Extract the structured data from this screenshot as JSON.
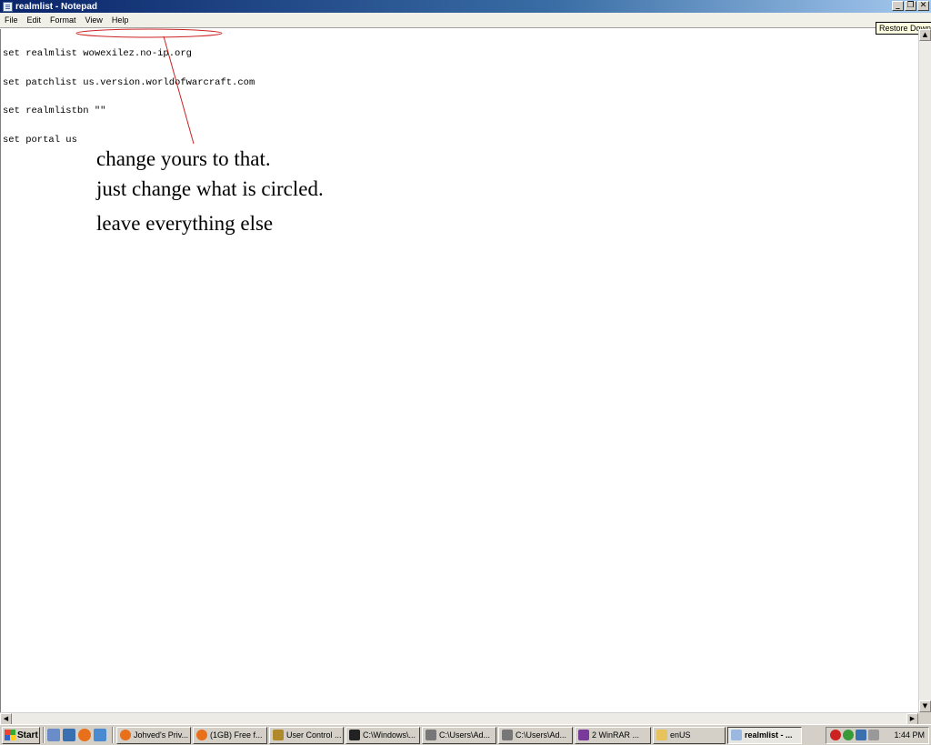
{
  "window": {
    "title": "realmlist - Notepad",
    "buttons": {
      "minimize": "_",
      "restore": "❐",
      "close": "✕"
    },
    "tooltip": "Restore Down"
  },
  "menu": [
    "File",
    "Edit",
    "Format",
    "View",
    "Help"
  ],
  "document": {
    "lines": [
      "set realmlist wowexilez.no-ip.org",
      "set patchlist us.version.worldofwarcraft.com",
      "set realmlistbn \"\"",
      "set portal us"
    ],
    "annotations": [
      "change yours to that.",
      "just change what is circled.",
      "leave everything else"
    ],
    "annotation_color": "#cc2222"
  },
  "scrollbars": {
    "up": "▲",
    "down": "▼",
    "left": "◀",
    "right": "▶"
  },
  "taskbar": {
    "start_label": "Start",
    "tasks": [
      {
        "label": "Johved's Priv...",
        "icon": "firefox-icon",
        "color": "#e8701a"
      },
      {
        "label": "(1GB) Free f...",
        "icon": "firefox-icon",
        "color": "#e8701a"
      },
      {
        "label": "User Control ...",
        "icon": "wow-icon",
        "color": "#b08a2a"
      },
      {
        "label": "C:\\Windows\\...",
        "icon": "cmd-icon",
        "color": "#222222"
      },
      {
        "label": "C:\\Users\\Ad...",
        "icon": "folder-icon",
        "color": "#777777"
      },
      {
        "label": "C:\\Users\\Ad...",
        "icon": "folder-icon",
        "color": "#777777"
      },
      {
        "label": "2 WinRAR ...",
        "icon": "winrar-icon",
        "color": "#7a3a9a"
      },
      {
        "label": "enUS",
        "icon": "folder-icon",
        "color": "#e6c35c"
      },
      {
        "label": "realmlist - ...",
        "icon": "notepad-icon",
        "color": "#9ab8e0",
        "active": true
      }
    ],
    "clock": "1:44 PM"
  }
}
